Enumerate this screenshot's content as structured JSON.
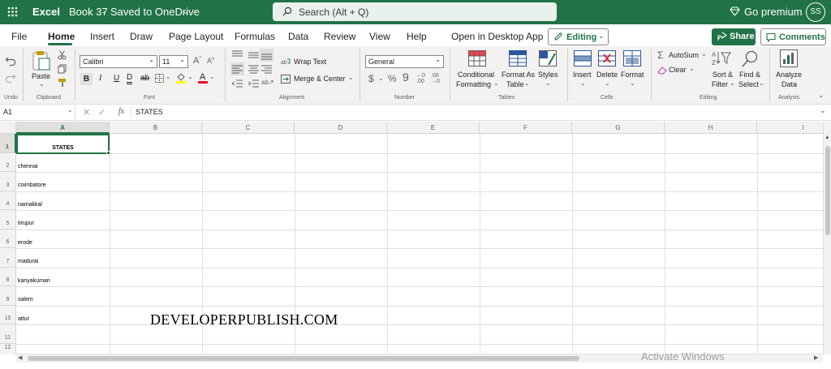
{
  "titlebar": {
    "app": "Excel",
    "doc": "Book 37",
    "status": "Saved to OneDrive",
    "search_placeholder": "Search (Alt + Q)",
    "premium": "Go premium",
    "avatar": "SS"
  },
  "menu": {
    "file": "File",
    "home": "Home",
    "insert": "Insert",
    "draw": "Draw",
    "page_layout": "Page Layout",
    "formulas": "Formulas",
    "data": "Data",
    "review": "Review",
    "view": "View",
    "help": "Help",
    "open_desktop": "Open in Desktop App",
    "editing": "Editing",
    "share": "Share",
    "comments": "Comments"
  },
  "ribbon": {
    "undo_group": "Undo",
    "paste": "Paste",
    "clipboard_group": "Clipboard",
    "font_name": "Calibri",
    "font_size": "11",
    "font_group": "Font",
    "wrap_text": "Wrap Text",
    "merge_center": "Merge & Center",
    "alignment_group": "Alignment",
    "number_format": "General",
    "number_group": "Number",
    "conditional_formatting_1": "Conditional",
    "conditional_formatting_2": "Formatting",
    "format_as_table_1": "Format As",
    "format_as_table_2": "Table",
    "styles": "Styles",
    "tables_group": "Tables",
    "insert": "Insert",
    "delete": "Delete",
    "format": "Format",
    "cells_group": "Cells",
    "autosum": "AutoSum",
    "clear": "Clear",
    "sort_filter_1": "Sort &",
    "sort_filter_2": "Filter",
    "find_select_1": "Find &",
    "find_select_2": "Select",
    "editing_group": "Editing",
    "analyze_1": "Analyze",
    "analyze_2": "Data",
    "analysis_group": "Analysis"
  },
  "formula_bar": {
    "name_box": "A1",
    "fx": "fx",
    "content": "STATES"
  },
  "columns": [
    "A",
    "B",
    "C",
    "D",
    "E",
    "F",
    "G",
    "H",
    "I"
  ],
  "rows": [
    "1",
    "2",
    "3",
    "4",
    "5",
    "6",
    "7",
    "8",
    "9",
    "10",
    "11",
    "12"
  ],
  "cells": [
    "STATES",
    "chennai",
    "coimbatore",
    "namakkal",
    "tirupur",
    "erode",
    "madurai",
    "kanyakumari",
    "salem",
    "attur"
  ],
  "watermark": "DEVELOPERPUBLISH.COM",
  "activate": "Activate Windows",
  "colors": {
    "accent": "#217346",
    "ribbon": "#f3f2f1"
  }
}
